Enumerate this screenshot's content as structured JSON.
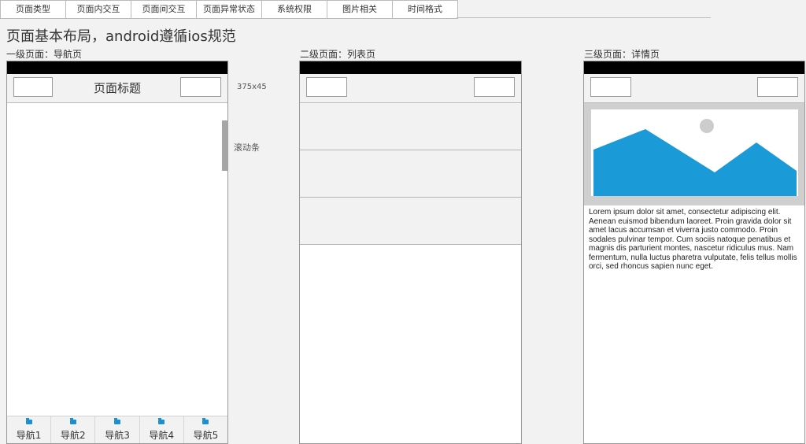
{
  "tabs": [
    "页面类型",
    "页面内交互",
    "页面间交互",
    "页面异常状态",
    "系统权限",
    "图片相关",
    "时间格式"
  ],
  "page_title": "页面基本布局，android遵循ios规范",
  "col1": {
    "label": "一级页面：导航页",
    "nav_title": "页面标题",
    "size_note": "375x45",
    "scroll_note": "滚动条",
    "tabbar": [
      "导航1",
      "导航2",
      "导航3",
      "导航4",
      "导航5"
    ],
    "tab_icon": "folder-icon"
  },
  "col2": {
    "label": "二级页面：列表页"
  },
  "col3": {
    "label": "三级页面：详情页",
    "image_icon": "image-placeholder-icon",
    "image_colors": {
      "sky": "#ffffff",
      "mountain": "#1a9ad6",
      "sun": "#cccccc",
      "frame": "#cfcfcf"
    },
    "body_text": "Lorem ipsum dolor sit amet, consectetur adipiscing elit. Aenean euismod bibendum laoreet. Proin gravida dolor sit amet lacus accumsan et viverra justo commodo. Proin sodales pulvinar tempor. Cum sociis natoque penatibus et magnis dis parturient montes, nascetur ridiculus mus. Nam fermentum, nulla luctus pharetra vulputate, felis tellus mollis orci, sed rhoncus sapien nunc eget."
  }
}
